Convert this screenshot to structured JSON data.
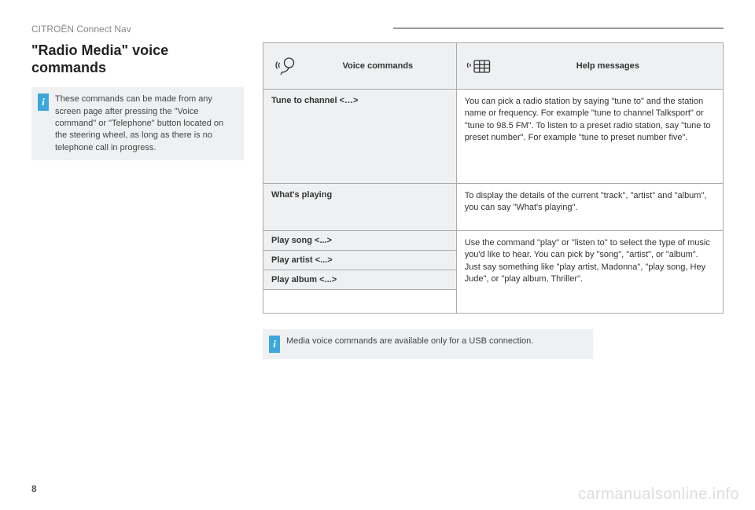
{
  "product_name": "CITROËN Connect Nav",
  "section_title": "\"Radio Media\" voice commands",
  "info_note": "These commands can be made from any screen page after pressing the \"Voice command\" or \"Telephone\" button located on the steering wheel, as long as there is no telephone call in progress.",
  "table": {
    "header_voice": "Voice commands",
    "header_help": "Help messages",
    "rows": [
      {
        "command": "Tune to channel <…>",
        "help": "You can pick a radio station by saying \"tune to\" and the station name or frequency. For example \"tune to channel Talksport\" or \"tune to 98.5 FM\". To listen to a preset radio station, say \"tune to preset number\". For example \"tune to preset number five\"."
      },
      {
        "command": "What's playing",
        "help": "To display the details of the current \"track\", \"artist\" and \"album\", you can say \"What's playing\"."
      },
      {
        "command": "Play song <...>",
        "help": "Use the command \"play\" or \"listen to\" to select the type of music you'd like to hear. You can pick by \"song\", \"artist\", or \"album\". Just say something like \"play artist, Madonna\", \"play song, Hey Jude\", or \"play album, Thriller\"."
      },
      {
        "command": "Play artist <...>"
      },
      {
        "command": "Play album <...>"
      }
    ]
  },
  "bottom_note": "Media voice commands are available only for a USB connection.",
  "page_num": "8",
  "watermark": "carmanualsonline.info"
}
